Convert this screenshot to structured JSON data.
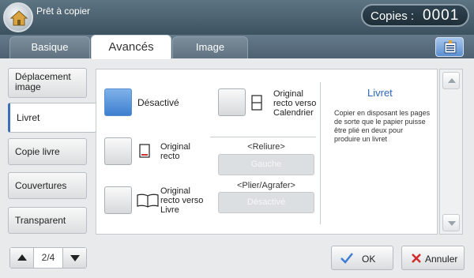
{
  "header": {
    "title": "Prêt à copier",
    "copies_label": "Copies :",
    "copies_value": "0001"
  },
  "tabs": [
    {
      "label": "Basique"
    },
    {
      "label": "Avancés"
    },
    {
      "label": "Image"
    }
  ],
  "nav": {
    "items": [
      {
        "label": "Déplacement image"
      },
      {
        "label": "Livret"
      },
      {
        "label": "Copie livre"
      },
      {
        "label": "Couvertures"
      },
      {
        "label": "Transparent"
      }
    ],
    "selected": "Livret"
  },
  "options": {
    "desactive": "Désactivé",
    "original_recto": "Original recto",
    "original_recto_verso_livre": "Original recto verso Livre",
    "original_recto_verso_calendrier": "Original recto verso Calendrier",
    "selected": "Désactivé"
  },
  "reliure": {
    "title": "<Reliure>",
    "value": "Gauche"
  },
  "plier": {
    "title": "<Plier/Agrafer>",
    "value": "Désactivé"
  },
  "info": {
    "title": "Livret",
    "text": "Copier en disposant les pages de sorte que le papier puisse être plié en deux pour produire un livret"
  },
  "pager": {
    "text": "2/4"
  },
  "actions": {
    "ok": "OK",
    "annuler": "Annuler"
  },
  "colors": {
    "accent": "#3d7fcf",
    "header": "#4d6172",
    "info_title": "#2c66b6"
  }
}
